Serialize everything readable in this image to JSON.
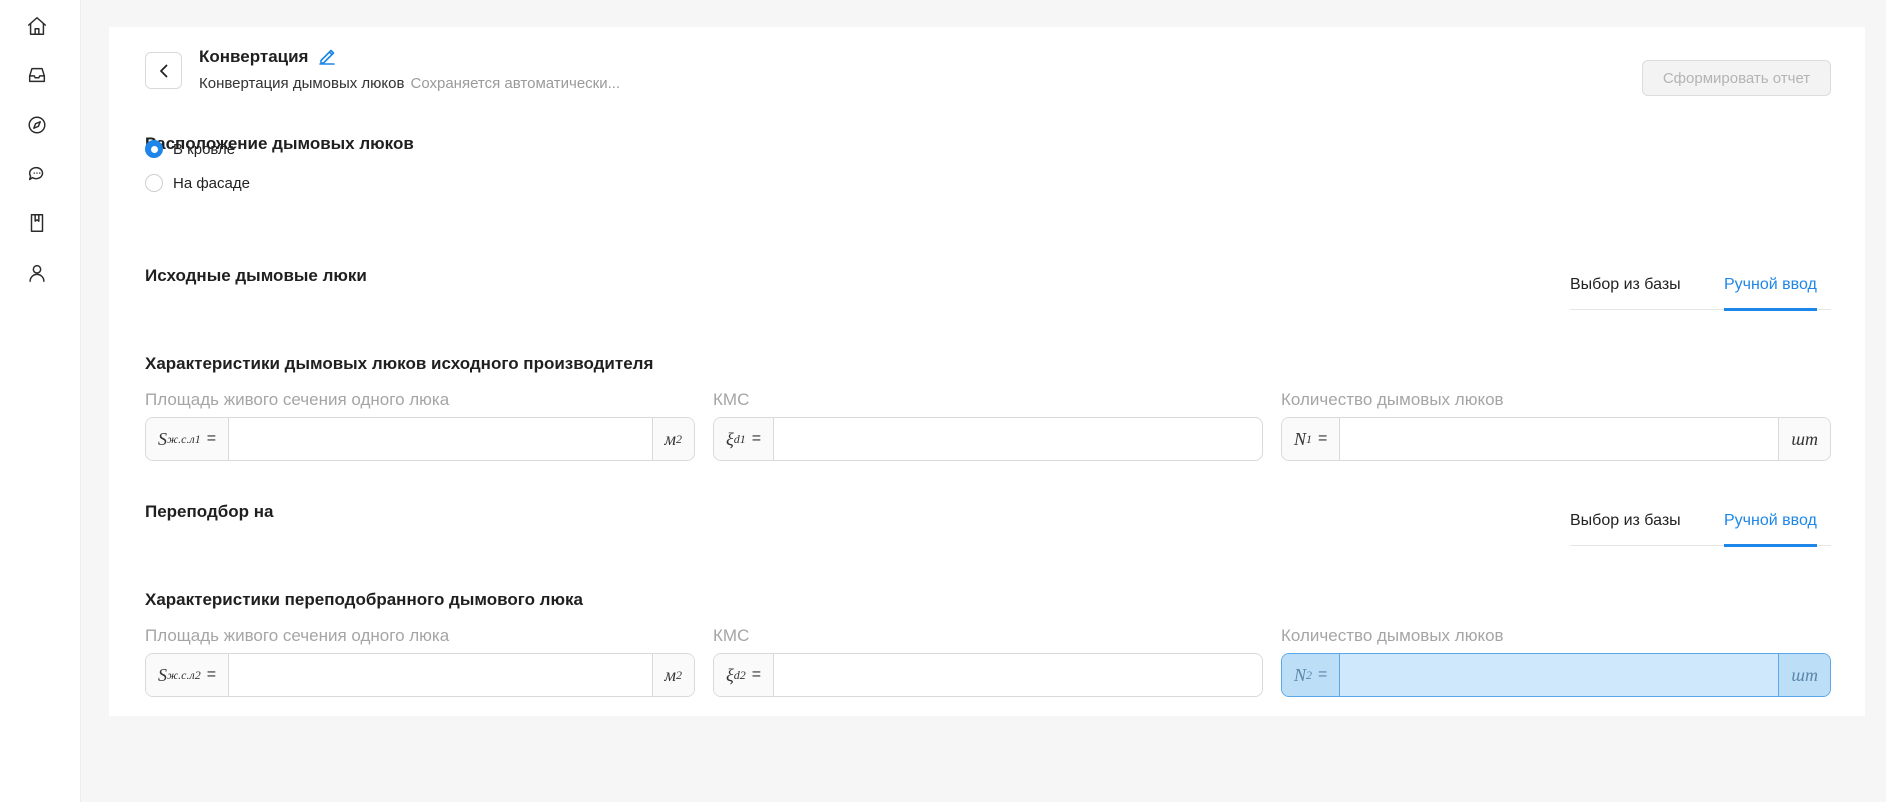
{
  "sidebar": {
    "items": [
      {
        "icon": "home-icon"
      },
      {
        "icon": "inbox-icon"
      },
      {
        "icon": "compass-icon"
      },
      {
        "icon": "chat-icon"
      },
      {
        "icon": "book-icon"
      },
      {
        "icon": "user-icon"
      }
    ]
  },
  "header": {
    "title": "Конвертация",
    "subtitle": "Конвертация дымовых люков",
    "autosave": "Сохраняется автоматически...",
    "report_button": "Сформировать отчет"
  },
  "location": {
    "title": "Расположение дымовых люков",
    "options": [
      "В кровле",
      "На фасаде"
    ],
    "selected": "В кровле"
  },
  "source": {
    "title": "Исходные дымовые люки",
    "tabs": [
      "Выбор из базы",
      "Ручной ввод"
    ],
    "active_tab": "Ручной ввод",
    "char_title": "Характеристики дымовых люков исходного производителя",
    "fields": {
      "area_label": "Площадь живого сечения одного люка",
      "area_symbol": "S",
      "area_sub": "ж.с.л1",
      "area_unit": "м",
      "area_unit_sup": "2",
      "area_value": "",
      "kms_label": "КМС",
      "kms_symbol": "ξ",
      "kms_sub": "d1",
      "kms_value": "",
      "count_label": "Количество дымовых люков",
      "count_symbol": "N",
      "count_sub": "1",
      "count_unit": "шт",
      "count_value": ""
    }
  },
  "target": {
    "title": "Переподбор на",
    "tabs": [
      "Выбор из базы",
      "Ручной ввод"
    ],
    "active_tab": "Ручной ввод",
    "char_title": "Характеристики переподобранного дымового люка",
    "fields": {
      "area_label": "Площадь живого сечения одного люка",
      "area_symbol": "S",
      "area_sub": "ж.с.л2",
      "area_unit": "м",
      "area_unit_sup": "2",
      "area_value": "",
      "kms_label": "КМС",
      "kms_symbol": "ξ",
      "kms_sub": "d2",
      "kms_value": "",
      "count_label": "Количество дымовых люков",
      "count_symbol": "N",
      "count_sub": "2",
      "count_unit": "шт",
      "count_value": ""
    }
  },
  "equals_sign": "=",
  "colors": {
    "accent": "#1d86e8",
    "highlight_field": "#cfe8fb",
    "disabled_text": "#b4b4b4",
    "label_gray": "#a5a5a5"
  }
}
